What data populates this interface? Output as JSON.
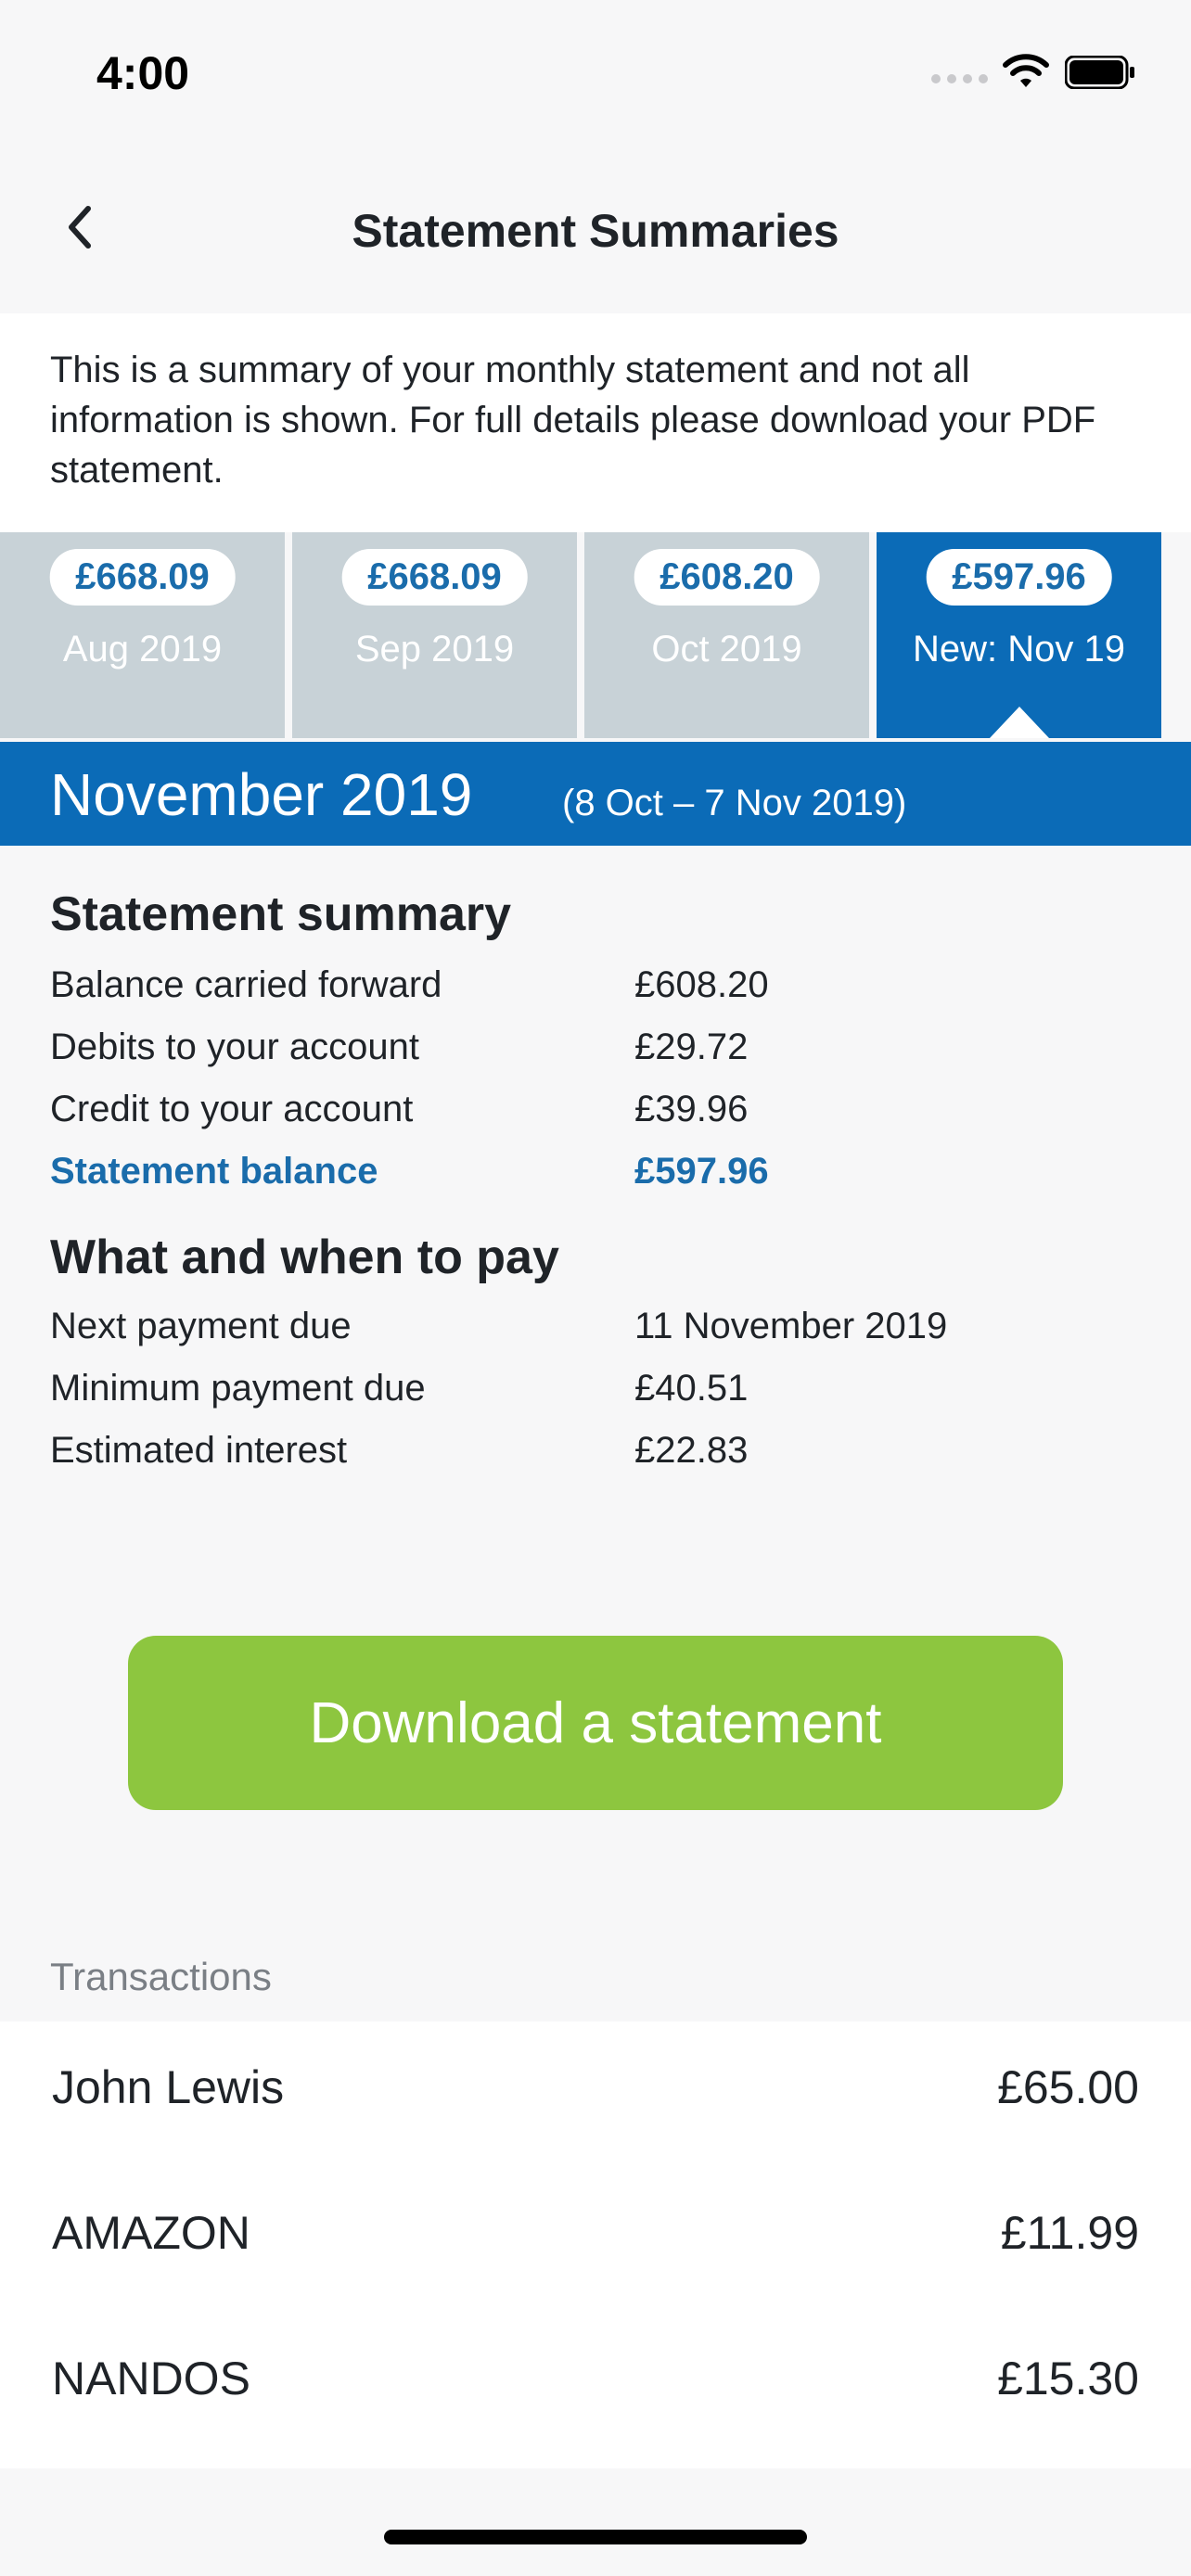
{
  "status_bar": {
    "time": "4:00"
  },
  "nav": {
    "title": "Statement Summaries"
  },
  "intro": {
    "text": "This is a summary of your monthly statement and not all information is shown. For full details please download your PDF statement."
  },
  "tabs": [
    {
      "amount": "£668.09",
      "date": "Aug 2019",
      "active": false
    },
    {
      "amount": "£668.09",
      "date": "Sep 2019",
      "active": false
    },
    {
      "amount": "£608.20",
      "date": "Oct 2019",
      "active": false
    },
    {
      "amount": "£597.96",
      "date": "New: Nov 19",
      "active": true
    }
  ],
  "banner": {
    "month": "November 2019",
    "range": "(8 Oct – 7 Nov 2019)"
  },
  "summary": {
    "heading": "Statement summary",
    "rows": [
      {
        "label": "Balance carried forward",
        "value": "£608.20"
      },
      {
        "label": "Debits to your account",
        "value": "£29.72"
      },
      {
        "label": "Credit to your account",
        "value": "£39.96"
      },
      {
        "label": "Statement balance",
        "value": "£597.96"
      }
    ]
  },
  "pay": {
    "heading": "What and when to pay",
    "rows": [
      {
        "label": "Next payment due",
        "value": "11 November 2019"
      },
      {
        "label": "Minimum payment due",
        "value": "£40.51"
      },
      {
        "label": "Estimated interest",
        "value": "£22.83"
      }
    ]
  },
  "download": {
    "label": "Download a statement"
  },
  "transactions": {
    "label": "Transactions",
    "items": [
      {
        "name": "John Lewis",
        "amount": "£65.00"
      },
      {
        "name": "AMAZON",
        "amount": "£11.99"
      },
      {
        "name": "NANDOS",
        "amount": "£15.30"
      }
    ]
  },
  "colors": {
    "accent": "#0b6bb7",
    "button": "#8dc63f",
    "tab_inactive": "#c8d2d7"
  }
}
